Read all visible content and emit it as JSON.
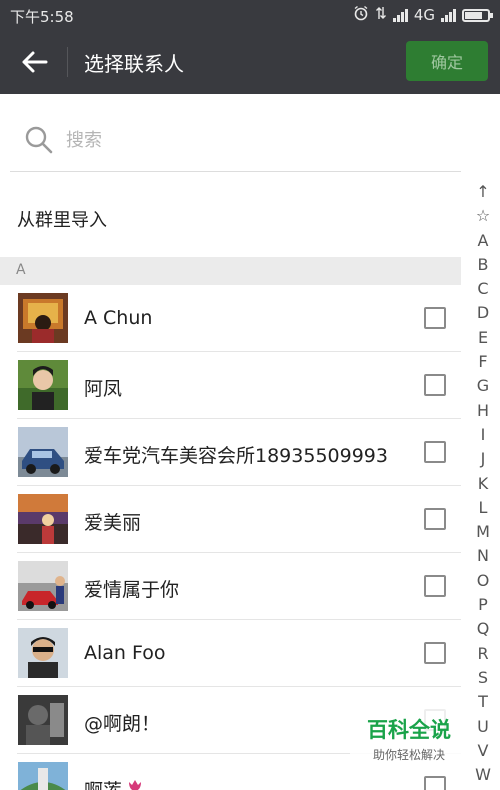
{
  "status_bar": {
    "time": "下午5:58",
    "network": "4G"
  },
  "header": {
    "title": "选择联系人",
    "confirm_label": "确定"
  },
  "search": {
    "placeholder": "搜索"
  },
  "import_group_label": "从群里导入",
  "section": "A",
  "contacts": [
    {
      "name": "A Chun",
      "checked": false
    },
    {
      "name": "阿凤",
      "checked": false
    },
    {
      "name": "爱车党汽车美容会所18935509993",
      "checked": false
    },
    {
      "name": "爱美丽",
      "checked": false
    },
    {
      "name": "爱情属于你",
      "checked": false
    },
    {
      "name": "Alan Foo",
      "checked": false
    },
    {
      "name": "@啊朗！",
      "checked": false
    },
    {
      "name": "啊莲",
      "checked": false
    }
  ],
  "index_letters": [
    "↑",
    "☆",
    "A",
    "B",
    "C",
    "D",
    "E",
    "F",
    "G",
    "H",
    "I",
    "J",
    "K",
    "L",
    "M",
    "N",
    "O",
    "P",
    "Q",
    "R",
    "S",
    "T",
    "U",
    "V",
    "W"
  ],
  "watermark": {
    "title": "百科全说",
    "subtitle": "助你轻松解决"
  },
  "colors": {
    "header_bg": "#393a3f",
    "confirm_bg": "#2e7d32",
    "section_bg": "#ebebeb",
    "watermark_green": "#1aa34a"
  }
}
